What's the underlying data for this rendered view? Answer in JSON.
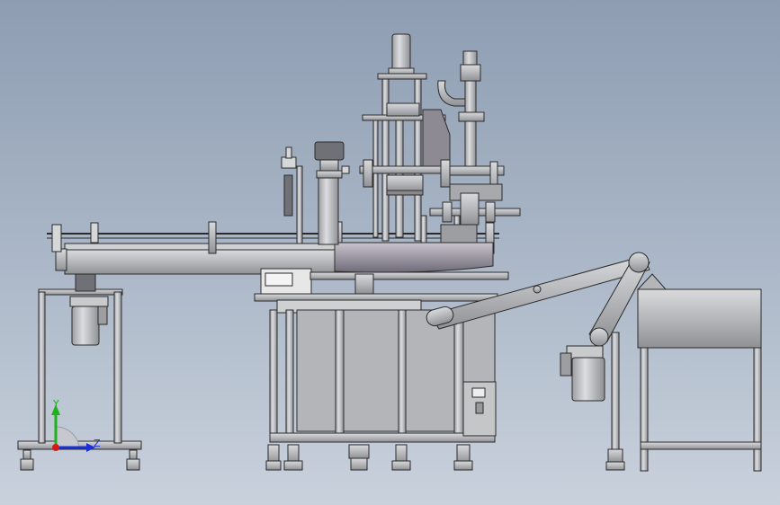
{
  "triad": {
    "y_label": "Y",
    "z_label": "Z",
    "y_color": "#1bb21b",
    "z_color": "#1c2fd6",
    "origin_color": "#d51a1a"
  },
  "colors": {
    "background_top": "#8e9db2",
    "background_bottom": "#c9d1dc",
    "metal": "#b9bbbe",
    "metal_dark": "#8a8c90",
    "outline": "#2b2b2b"
  }
}
